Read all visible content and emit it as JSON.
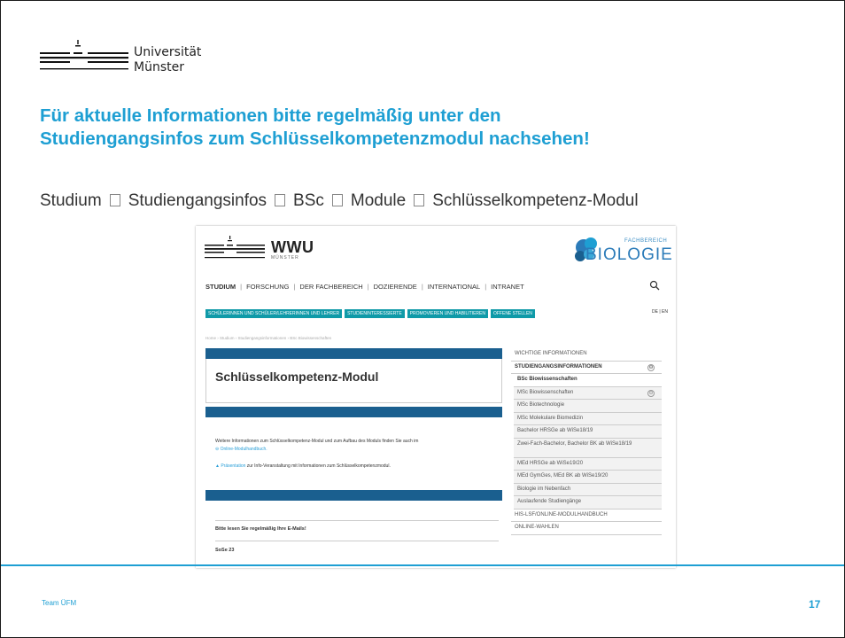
{
  "logo": {
    "line1": "Universität",
    "line2": "Münster"
  },
  "headline": {
    "line1": "Für aktuelle Informationen bitte regelmäßig unter den",
    "line2": "Studiengangsinfos zum Schlüsselkompetenzmodul nachsehen!"
  },
  "breadcrumb": [
    "Studium",
    "Studiengangsinfos",
    "BSc",
    "Module",
    "Schlüsselkompetenz-Modul"
  ],
  "screenshot": {
    "wwu": {
      "name": "WWU",
      "sub": "MÜNSTER"
    },
    "bio": {
      "fachbereich": "FACHBEREICH",
      "name": "BIOLOGIE"
    },
    "nav": [
      "STUDIUM",
      "FORSCHUNG",
      "DER FACHBEREICH",
      "DOZIERENDE",
      "INTERNATIONAL",
      "INTRANET"
    ],
    "teal_buttons": [
      "SCHÜLERINNEN UND SCHÜLER/LEHRERINNEN UND LEHRER",
      "STUDIENINTERESSIERTE",
      "PROMOVIEREN UND HABILITIEREN",
      "OFFENE STELLEN"
    ],
    "lang": "DE | EN",
    "page_title": "Schlüsselkompetenz-Modul",
    "para1": "Weitere Informationen zum Schlüsselkompetenz-Modul und zum Aufbau des Moduls finden Sie auch im",
    "para1_link": "Online-Modulhandbuch.",
    "para2_link": "Präsentation",
    "para2": " zur Info-Veranstaltung mit Informationen zum Schlüsselkompetenzmodul.",
    "mail_note": "Bitte lesen Sie regelmäßig Ihre E-Mails!",
    "semester": "SoSe 23",
    "sidebar": [
      {
        "label": "WICHTIGE INFORMATIONEN",
        "kind": "top"
      },
      {
        "label": "STUDIENGANGSINFORMATIONEN",
        "kind": "hdr",
        "icon": "⊖"
      },
      {
        "label": "BSc Biowissenschaften",
        "kind": "sel"
      },
      {
        "label": "MSc Biowissenschaften",
        "kind": "sub",
        "icon": "⊖"
      },
      {
        "label": "MSc Biotechnologie",
        "kind": "sub"
      },
      {
        "label": "MSc Molekulare Biomedizin",
        "kind": "sub"
      },
      {
        "label": "Bachelor HRSGe ab WiSe18/19",
        "kind": "sub"
      },
      {
        "label": "Zwei-Fach-Bachelor, Bachelor BK ab WiSe18/19",
        "kind": "sub tall"
      },
      {
        "label": "MEd HRSGe ab WiSe19/20",
        "kind": "sub"
      },
      {
        "label": "MEd GymGes, MEd BK ab WiSe19/20",
        "kind": "sub"
      },
      {
        "label": "Biologie im Nebenfach",
        "kind": "sub"
      },
      {
        "label": "Auslaufende Studiengänge",
        "kind": "sub"
      },
      {
        "label": "HIS-LSF/ONLINE-MODULHANDBUCH",
        "kind": "top"
      },
      {
        "label": "ONLINE-WAHLEN",
        "kind": "top"
      }
    ]
  },
  "footer": {
    "team": "Team ÜFM",
    "page": "17"
  },
  "colors": {
    "accent": "#1e9fd3",
    "wwu_blue": "#1a5f8f",
    "teal": "#0f9aa8"
  }
}
